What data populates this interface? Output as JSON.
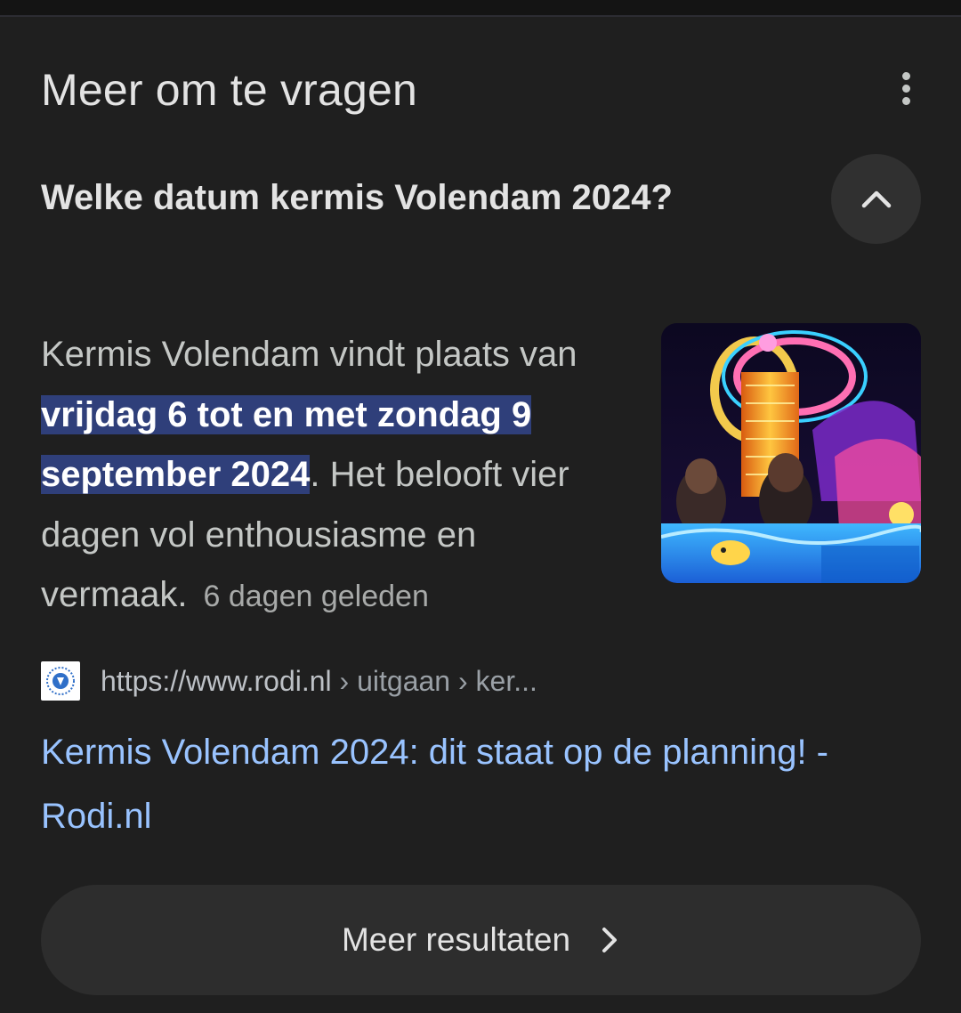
{
  "section": {
    "title": "Meer om te vragen",
    "more_icon": "more-vert-icon"
  },
  "question": {
    "text": "Welke datum kermis Volendam 2024?",
    "toggle_icon": "chevron-up-icon",
    "expanded": true
  },
  "answer": {
    "before": "Kermis Volendam vindt plaats van ",
    "highlight": "vrijdag 6 tot en met zondag 9 september 2024",
    "after": ". Het belooft vier dagen vol enthousiasme en vermaak.",
    "age": "6 dagen geleden",
    "highlight_color": "#2f3f7a"
  },
  "source": {
    "url": "https://www.rodi.nl",
    "path": " › uitgaan › ker...",
    "favicon": "rodi-favicon"
  },
  "result": {
    "title": "Kermis Volendam 2024: dit staat op de planning! - Rodi.nl",
    "link_color": "#99c3ff"
  },
  "more_results": {
    "label": "Meer resultaten",
    "icon": "chevron-right-icon"
  },
  "theme": {
    "background": "#1f1f1f",
    "text": "#e3e3e3",
    "secondary_text": "#c4c7c5",
    "button_background": "#2d2d2d"
  }
}
